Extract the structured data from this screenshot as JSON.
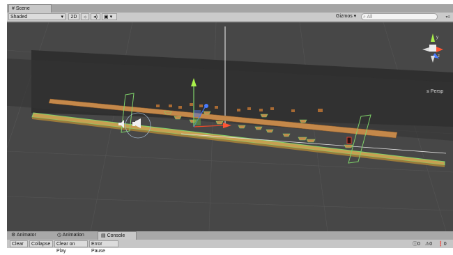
{
  "scene_tab": {
    "label": "Scene",
    "icon": "grid-icon"
  },
  "toolbar": {
    "shading": "Shaded",
    "mode_2d": "2D",
    "light_icon": "sun-icon",
    "audio_icon": "speaker-icon",
    "effects_icon": "image-icon",
    "gizmos": "Gizmos",
    "search_placeholder": "All"
  },
  "viewport": {
    "projection": "Persp"
  },
  "bottom_tabs": [
    {
      "label": "Animator",
      "icon": "animator-icon"
    },
    {
      "label": "Animation",
      "icon": "clock-icon"
    },
    {
      "label": "Console",
      "icon": "console-icon"
    }
  ],
  "console": {
    "clear": "Clear",
    "collapse": "Collapse",
    "clear_on_play": "Clear on Play",
    "error_pause": "Error Pause",
    "info_count": "0",
    "warning_count": "0",
    "error_count": "0"
  },
  "colors": {
    "viewport_bg": "#474747",
    "platform": "#c4884a",
    "collider": "#7fd36a"
  }
}
